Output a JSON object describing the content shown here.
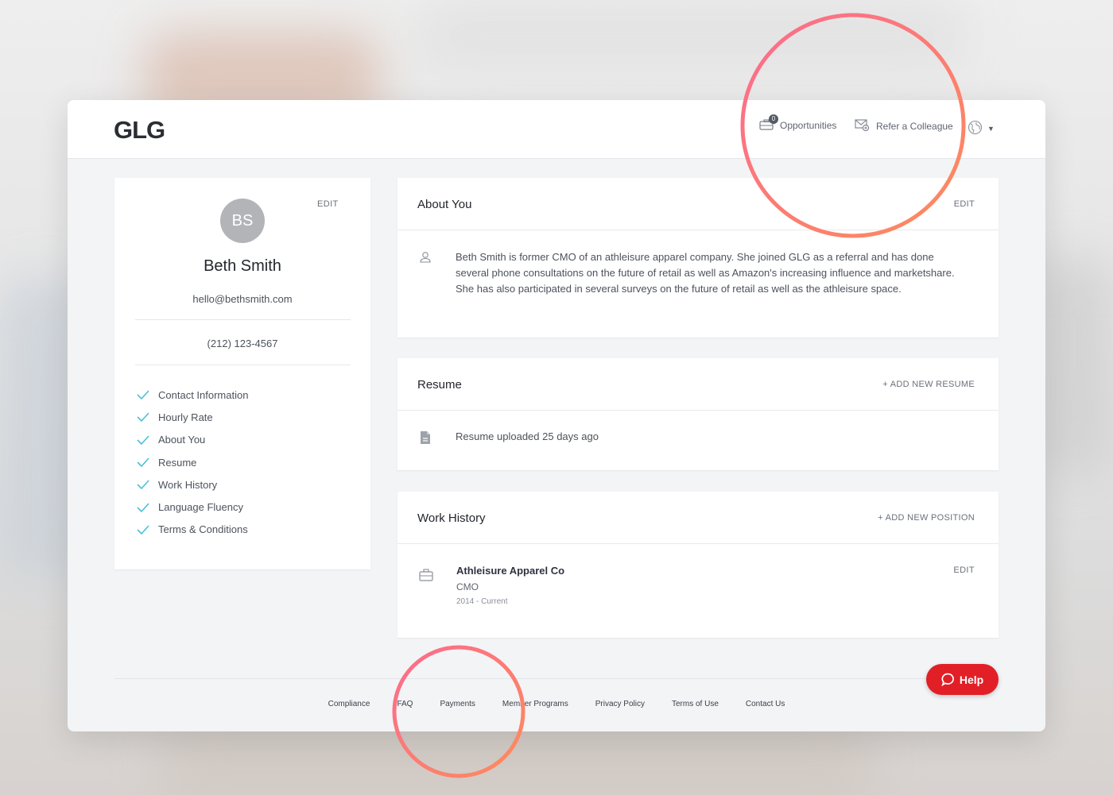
{
  "header": {
    "logo": "GLG",
    "opportunities_label": "Opportunities",
    "opportunities_count": "0",
    "refer_label": "Refer a Colleague"
  },
  "profile": {
    "initials": "BS",
    "edit_label": "EDIT",
    "name": "Beth Smith",
    "email": "hello@bethsmith.com",
    "phone": "(212) 123-4567",
    "checklist": [
      "Contact Information",
      "Hourly Rate",
      "About You",
      "Resume",
      "Work History",
      "Language Fluency",
      "Terms & Conditions"
    ]
  },
  "about": {
    "title": "About You",
    "edit_label": "EDIT",
    "text": "Beth Smith is former CMO of an athleisure apparel company. She joined GLG as a referral and has done several phone consultations on the future of retail as well as Amazon's increasing influence and marketshare. She has also participated in several surveys on the future of retail as well as the athleisure space."
  },
  "resume": {
    "title": "Resume",
    "action_label": "+ ADD NEW RESUME",
    "status": "Resume uploaded 25 days ago"
  },
  "work": {
    "title": "Work History",
    "action_label": "+ ADD NEW POSITION",
    "company": "Athleisure Apparel Co",
    "role": "CMO",
    "years": "2014 - Current",
    "edit_label": "EDIT"
  },
  "footer": {
    "links": [
      "Compliance",
      "FAQ",
      "Payments",
      "Member Programs",
      "Privacy Policy",
      "Terms of Use",
      "Contact Us"
    ]
  },
  "help": {
    "label": "Help"
  },
  "colors": {
    "accent_check": "#4fc0d8",
    "help_red": "#e21f26",
    "ring_start": "#fb6b8f",
    "ring_end": "#fd8c5b"
  }
}
